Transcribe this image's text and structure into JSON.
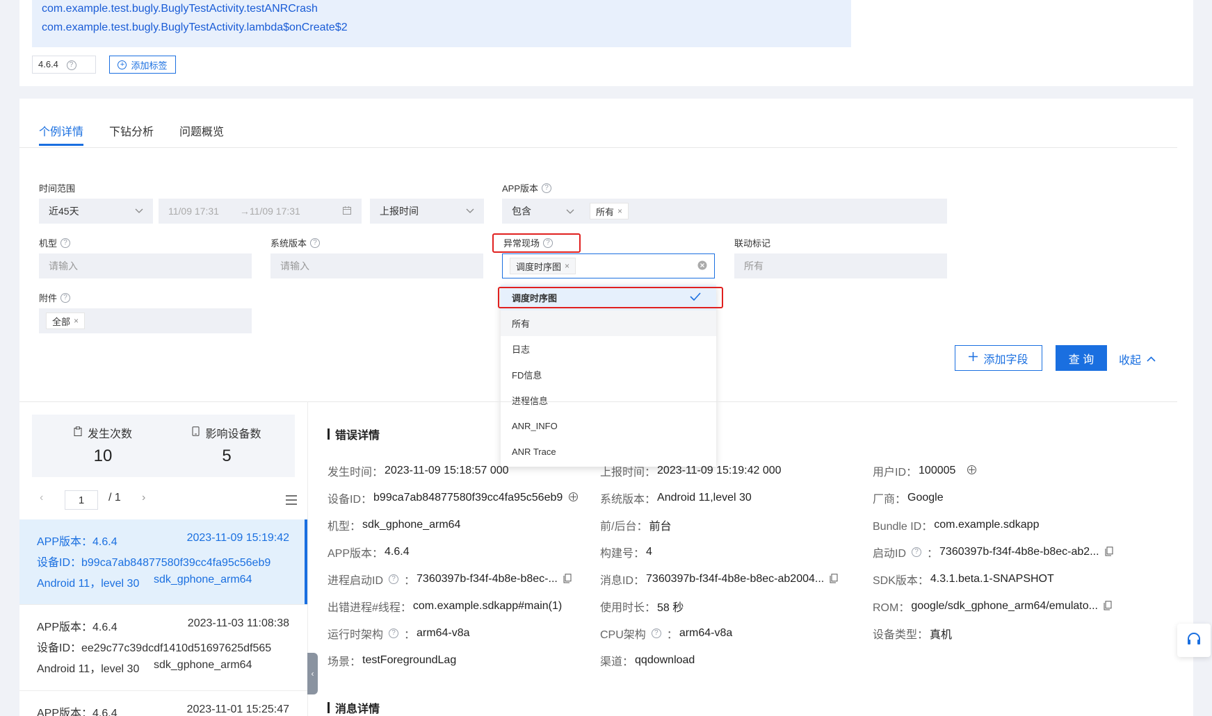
{
  "stack": {
    "lines": [
      "com.example.test.bugly.BuglyTestActivity.testANRCrash",
      "com.example.test.bugly.BuglyTestActivity.lambda$onCreate$2"
    ],
    "version": "4.6.4",
    "add_tag_label": "添加标签"
  },
  "tabs": [
    "个例详情",
    "下钻分析",
    "问题概览"
  ],
  "filters": {
    "time_range": {
      "label": "时间范围",
      "preset": "近45天",
      "start": "11/09 17:31",
      "end": "→11/09 17:31",
      "type": "上报时间"
    },
    "app_version": {
      "label": "APP版本",
      "op": "包含",
      "tag": "所有"
    },
    "model": {
      "label": "机型",
      "placeholder": "请输入"
    },
    "os_version": {
      "label": "系统版本",
      "placeholder": "请输入"
    },
    "scene": {
      "label": "异常现场",
      "tag": "调度时序图"
    },
    "linked_tag": {
      "label": "联动标记",
      "placeholder": "所有"
    },
    "attachment": {
      "label": "附件",
      "tag": "全部"
    }
  },
  "dropdown": {
    "selected": "调度时序图",
    "items": [
      "所有",
      "日志",
      "FD信息",
      "进程信息",
      "ANR_INFO",
      "ANR Trace"
    ]
  },
  "buttons": {
    "add_field": "添加字段",
    "query": "查 询",
    "collapse": "收起"
  },
  "stats": {
    "occurrences_label": "发生次数",
    "occurrences": "10",
    "devices_label": "影响设备数",
    "devices": "5"
  },
  "pager": {
    "current": "1",
    "total": "/ 1"
  },
  "records": [
    {
      "app": "APP版本：4.6.4",
      "time": "2023-11-09 15:19:42",
      "device": "设备ID：b99ca7ab84877580f39cc4fa95c56eb9",
      "os": "Android 11，level 30",
      "model": "sdk_gphone_arm64"
    },
    {
      "app": "APP版本：4.6.4",
      "time": "2023-11-03 11:08:38",
      "device": "设备ID：ee29c77c39dcdf1410d51697625df565",
      "os": "Android 11，level 30",
      "model": "sdk_gphone_arm64"
    },
    {
      "app": "APP版本：4.6.4",
      "time": "2023-11-01 15:25:47"
    }
  ],
  "details": {
    "title": "错误详情",
    "msg_title": "消息详情",
    "col1": [
      {
        "k": "发生时间：",
        "v": "2023-11-09 15:18:57 000"
      },
      {
        "k": "设备ID：",
        "v": "b99ca7ab84877580f39cc4fa95c56eb9"
      },
      {
        "k": "机型：",
        "v": "sdk_gphone_arm64"
      },
      {
        "k": "APP版本：",
        "v": "4.6.4"
      },
      {
        "k": "进程启动ID",
        "v": "7360397b-f34f-4b8e-b8ec-..."
      },
      {
        "k": "出错进程#线程：",
        "v": "com.example.sdkapp#main(1)"
      },
      {
        "k": "运行时架构",
        "v": "arm64-v8a"
      },
      {
        "k": "场景：",
        "v": "testForegroundLag"
      }
    ],
    "col2": [
      {
        "k": "上报时间：",
        "v": "2023-11-09 15:19:42 000"
      },
      {
        "k": "系统版本：",
        "v": "Android 11,level 30"
      },
      {
        "k": "前/后台：",
        "v": "前台"
      },
      {
        "k": "构建号：",
        "v": "4"
      },
      {
        "k": "消息ID：",
        "v": "7360397b-f34f-4b8e-b8ec-ab2004..."
      },
      {
        "k": "使用时长：",
        "v": "58 秒"
      },
      {
        "k": "CPU架构",
        "v": "arm64-v8a"
      },
      {
        "k": "渠道：",
        "v": "qqdownload"
      }
    ],
    "col3": [
      {
        "k": "用户ID：",
        "v": "100005"
      },
      {
        "k": "厂商：",
        "v": "Google"
      },
      {
        "k": "Bundle ID：",
        "v": "com.example.sdkapp"
      },
      {
        "k": "启动ID",
        "v": "7360397b-f34f-4b8e-b8ec-ab2..."
      },
      {
        "k": "SDK版本：",
        "v": "4.3.1.beta.1-SNAPSHOT"
      },
      {
        "k": "ROM：",
        "v": "google/sdk_gphone_arm64/emulato..."
      },
      {
        "k": "设备类型：",
        "v": "真机"
      }
    ]
  },
  "colors": {
    "accent": "#1a6fe0",
    "highlight_red": "#e0201f",
    "selected_bg": "#e3f0fc"
  }
}
